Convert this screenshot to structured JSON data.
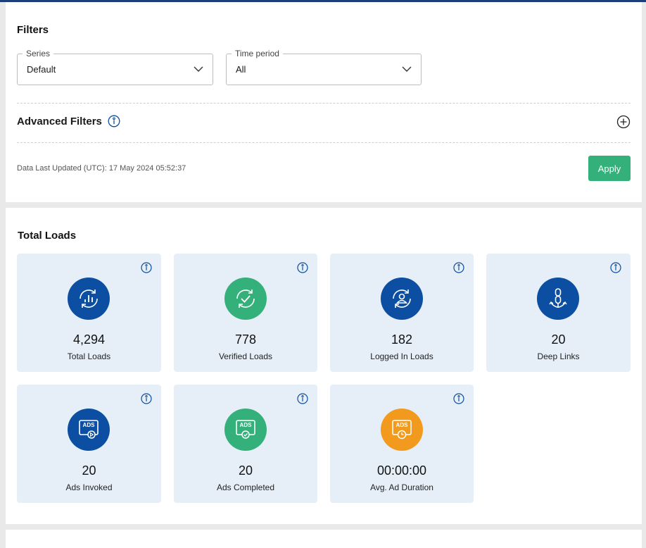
{
  "filters": {
    "title": "Filters",
    "series": {
      "label": "Series",
      "value": "Default"
    },
    "time_period": {
      "label": "Time period",
      "value": "All"
    },
    "advanced": {
      "title": "Advanced Filters"
    },
    "last_updated": "Data Last Updated (UTC): 17 May 2024 05:52:37",
    "apply_label": "Apply"
  },
  "total_loads": {
    "title": "Total Loads",
    "cards": [
      {
        "value": "4,294",
        "label": "Total Loads",
        "icon": "total-loads-icon",
        "color": "#0b4ea2"
      },
      {
        "value": "778",
        "label": "Verified Loads",
        "icon": "verified-loads-icon",
        "color": "#34b07a"
      },
      {
        "value": "182",
        "label": "Logged In Loads",
        "icon": "logged-in-loads-icon",
        "color": "#0b4ea2"
      },
      {
        "value": "20",
        "label": "Deep Links",
        "icon": "deep-links-icon",
        "color": "#0b4ea2"
      },
      {
        "value": "20",
        "label": "Ads Invoked",
        "icon": "ads-invoked-icon",
        "color": "#0b4ea2",
        "badge": "ADS"
      },
      {
        "value": "20",
        "label": "Ads Completed",
        "icon": "ads-completed-icon",
        "color": "#34b07a",
        "badge": "ADS"
      },
      {
        "value": "00:00:00",
        "label": "Avg. Ad Duration",
        "icon": "avg-ad-duration-icon",
        "color": "#f29a1e",
        "badge": "ADS"
      }
    ]
  }
}
